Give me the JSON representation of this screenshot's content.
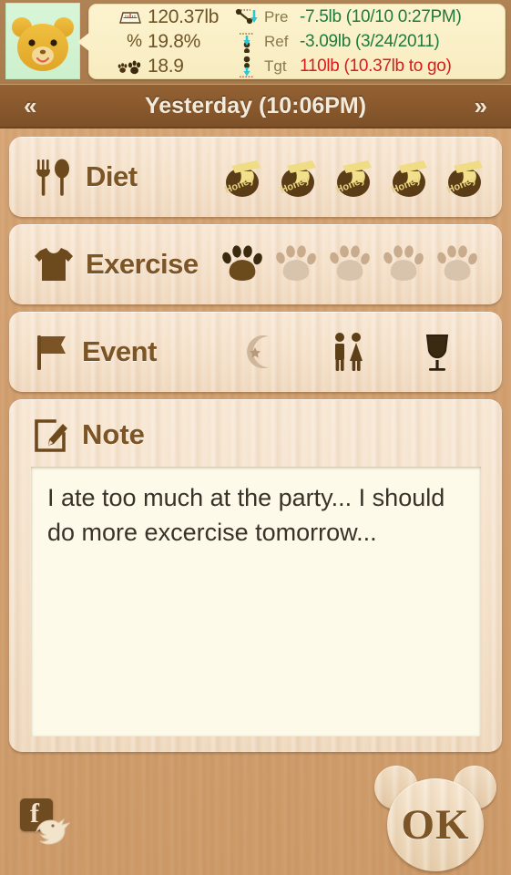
{
  "app": {
    "accent_brown": "#7b5526",
    "bar_brown": "#89592d",
    "bubble_cream": "#fbf0c8",
    "green": "#1f7a3d",
    "red": "#d81c1c"
  },
  "avatar": {
    "icon": "bear-avatar-icon"
  },
  "stats": {
    "left": [
      {
        "icon": "scale-icon",
        "value": "120.37lb"
      },
      {
        "icon": "percent-icon",
        "value": "19.8%"
      },
      {
        "icon": "paws-icon",
        "value": "18.9"
      }
    ],
    "right": [
      {
        "icon": "trend-down-icon",
        "label": "Pre",
        "value": "-7.5lb (10/10 0:27PM)",
        "tone": "green"
      },
      {
        "icon": "ref-arrow-icon",
        "label": "Ref",
        "value": "-3.09lb (3/24/2011)",
        "tone": "green"
      },
      {
        "icon": "target-arrow-icon",
        "label": "Tgt",
        "value": "110lb (10.37lb to go)",
        "tone": "red"
      }
    ]
  },
  "datebar": {
    "prev": "«",
    "title": "Yesterday (10:06PM)",
    "next": "»"
  },
  "rows": {
    "diet": {
      "label": "Diet",
      "icon": "fork-and-spoon-icon",
      "item_icon": "honey-pot-icon",
      "item_label": "Honey",
      "total": 5,
      "filled": 5
    },
    "exercise": {
      "label": "Exercise",
      "icon": "t-shirt-icon",
      "item_icon": "paw-print-icon",
      "total": 5,
      "filled": 1
    },
    "event": {
      "label": "Event",
      "icon": "flag-icon",
      "items": [
        {
          "icon": "crescent-moon-star-icon",
          "active": false
        },
        {
          "icon": "couple-icon",
          "active": true
        },
        {
          "icon": "wine-glass-icon",
          "active": true
        }
      ]
    },
    "note": {
      "label": "Note",
      "icon": "pencil-note-icon",
      "text": "I ate too much at the party... I should do more excercise tomorrow...",
      "placeholder": "Note"
    }
  },
  "footer": {
    "facebook_glyph": "f",
    "facebook_icon": "facebook-icon",
    "twitter_icon": "twitter-bird-icon",
    "ok_label": "OK"
  }
}
